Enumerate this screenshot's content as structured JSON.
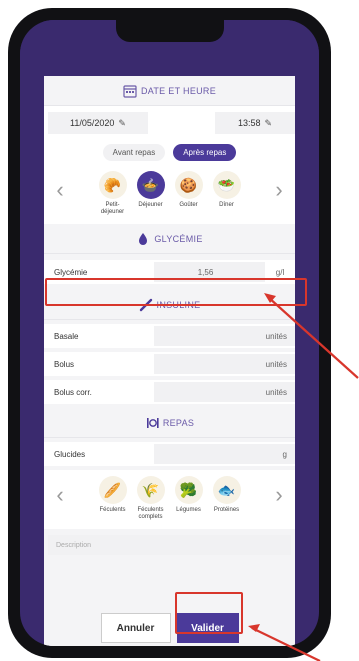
{
  "sections": {
    "date_time": "DATE ET HEURE",
    "glycemia": "GLYCÉMIE",
    "insulin": "INSULINE",
    "meals": "REPAS"
  },
  "date": {
    "value": "11/05/2020",
    "time": "13:58"
  },
  "meal_toggle": {
    "before": "Avant repas",
    "after": "Après repas",
    "selected": "after"
  },
  "meal_types": [
    {
      "label": "Petit-déjeuner",
      "icon": "croissant-icon"
    },
    {
      "label": "Déjeuner",
      "icon": "lunch-icon",
      "selected": true
    },
    {
      "label": "Goûter",
      "icon": "snack-icon"
    },
    {
      "label": "Dîner",
      "icon": "dinner-icon"
    }
  ],
  "glycemia": {
    "label": "Glycémie",
    "value": "1,56",
    "unit": "g/l"
  },
  "insulin": [
    {
      "label": "Basale",
      "unit": "unités"
    },
    {
      "label": "Bolus",
      "unit": "unités"
    },
    {
      "label": "Bolus corr.",
      "unit": "unités"
    }
  ],
  "carbs": {
    "label": "Glucides",
    "unit": "g"
  },
  "food_types": [
    {
      "label": "Féculents",
      "icon": "starch-icon"
    },
    {
      "label": "Féculents complets",
      "icon": "wholegrain-icon"
    },
    {
      "label": "Légumes",
      "icon": "vegetables-icon"
    },
    {
      "label": "Protéines",
      "icon": "protein-icon"
    }
  ],
  "description_placeholder": "Description",
  "buttons": {
    "cancel": "Annuler",
    "validate": "Valider"
  },
  "colors": {
    "accent": "#4b3a9a",
    "highlight": "#d8362c"
  }
}
